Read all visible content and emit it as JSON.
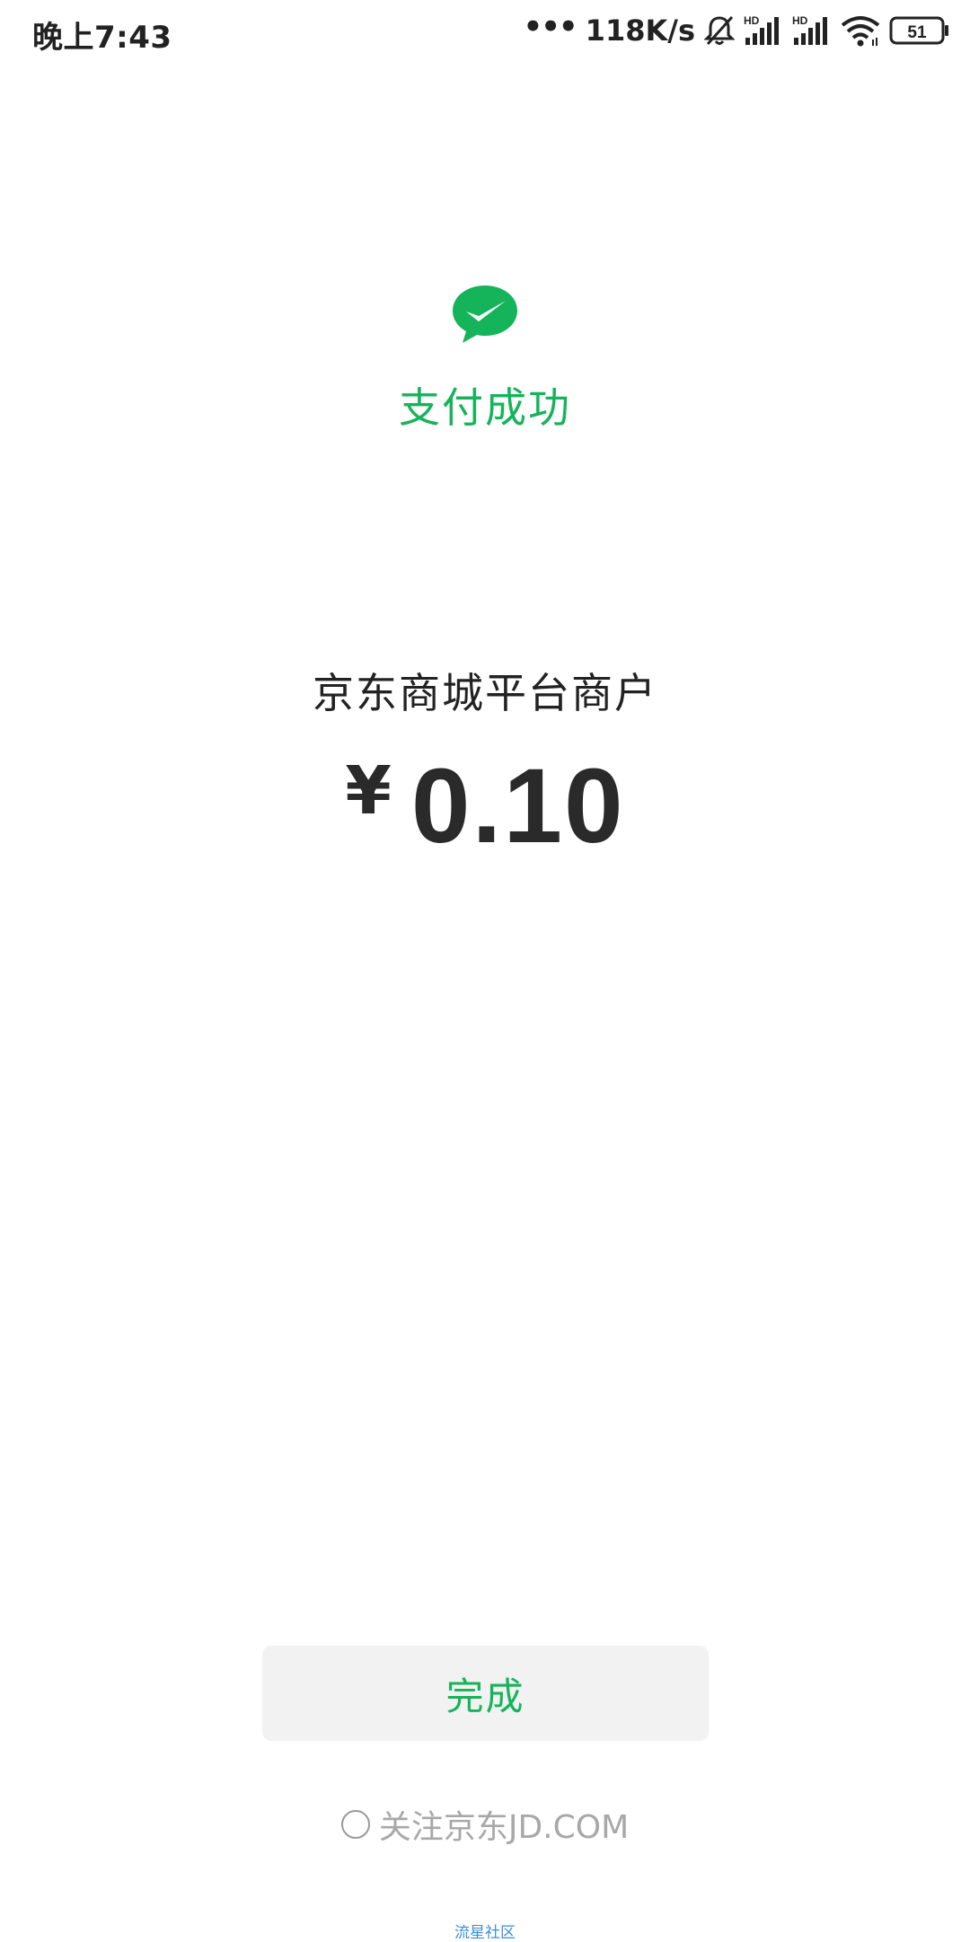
{
  "status_bar": {
    "time": "晚上7:43",
    "dots": "•••",
    "network_speed": "118K/s",
    "signal_1_label": "HD",
    "signal_2_label": "HD",
    "battery": "51",
    "icons": [
      "bell-muted-icon",
      "signal-hd-icon",
      "signal-hd-icon",
      "wifi-icon",
      "battery-icon"
    ]
  },
  "result": {
    "logo_icon": "wechat-pay-check-icon",
    "title": "支付成功",
    "accent_color": "#15b45a"
  },
  "payment": {
    "merchant": "京东商城平台商户",
    "currency_symbol": "¥",
    "amount": "0.10"
  },
  "actions": {
    "done_label": "完成",
    "follow_label": "关注京东JD.COM",
    "follow_checked": false
  },
  "watermark": {
    "text": "流星社区"
  }
}
